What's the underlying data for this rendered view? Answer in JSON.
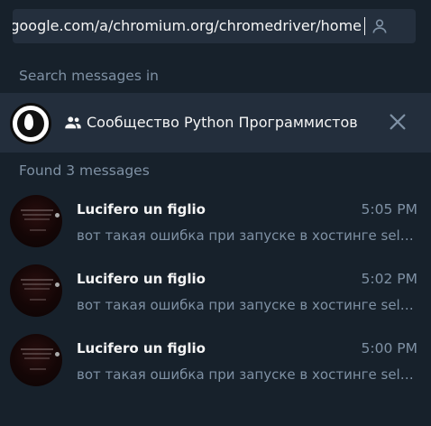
{
  "search": {
    "query": "google.com/a/chromium.org/chromedriver/home"
  },
  "scope_label": "Search messages in",
  "chat_filter": {
    "name": "Сообщество Python Программистов",
    "avatar_icon": "flame-logo-icon",
    "type_icon": "group-icon",
    "close_icon": "close-icon"
  },
  "results_label": "Found 3 messages",
  "messages": [
    {
      "sender": "Lucifero un figlio",
      "time": "5:05 PM",
      "preview": "вот такая ошибка при запуске в хостинге selenium"
    },
    {
      "sender": "Lucifero un figlio",
      "time": "5:02 PM",
      "preview": "вот такая ошибка при запуске в хостинге selenium"
    },
    {
      "sender": "Lucifero un figlio",
      "time": "5:00 PM",
      "preview": "вот такая ошибка при запуске в хостинге selenium"
    }
  ],
  "colors": {
    "background": "#17212b",
    "field": "#242f3d",
    "secondary_text": "#7f91a4",
    "primary_text": "#f5f5f5",
    "selected_chat_bg": "#232e3c"
  }
}
